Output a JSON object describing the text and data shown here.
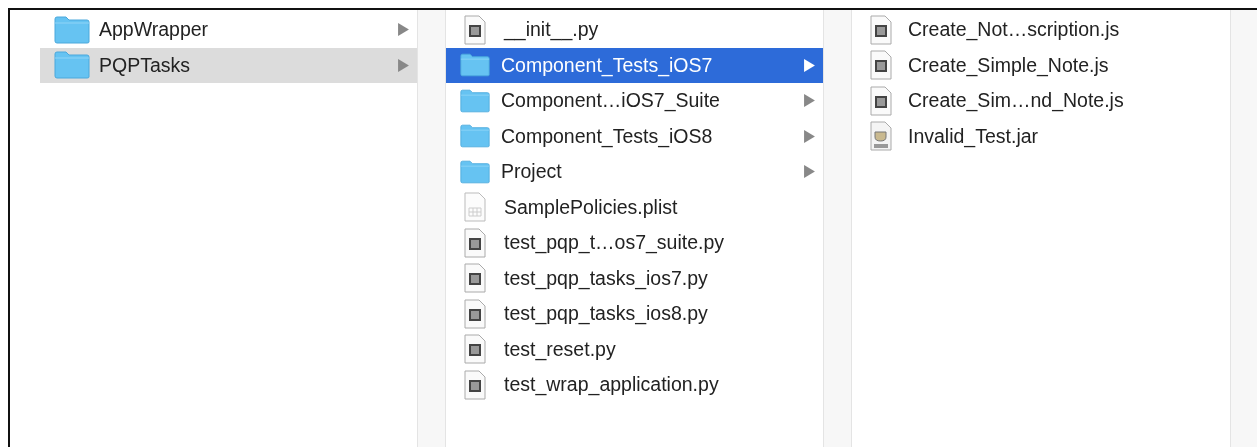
{
  "columns": [
    {
      "items": [
        {
          "kind": "folder",
          "name": "AppWrapper",
          "selected": false
        },
        {
          "kind": "folder",
          "name": "PQPTasks",
          "selected": true
        }
      ]
    },
    {
      "items": [
        {
          "kind": "script",
          "name": "__init__.py",
          "selected": false
        },
        {
          "kind": "folder",
          "name": "Component_Tests_iOS7",
          "selected": true
        },
        {
          "kind": "folder",
          "name": "Component…iOS7_Suite",
          "selected": false
        },
        {
          "kind": "folder",
          "name": "Component_Tests_iOS8",
          "selected": false
        },
        {
          "kind": "folder",
          "name": "Project",
          "selected": false
        },
        {
          "kind": "plist",
          "name": "SamplePolicies.plist",
          "selected": false
        },
        {
          "kind": "script",
          "name": "test_pqp_t…os7_suite.py",
          "selected": false
        },
        {
          "kind": "script",
          "name": "test_pqp_tasks_ios7.py",
          "selected": false
        },
        {
          "kind": "script",
          "name": "test_pqp_tasks_ios8.py",
          "selected": false
        },
        {
          "kind": "script",
          "name": "test_reset.py",
          "selected": false
        },
        {
          "kind": "script",
          "name": "test_wrap_application.py",
          "selected": false
        }
      ]
    },
    {
      "items": [
        {
          "kind": "script",
          "name": "Create_Not…scription.js",
          "selected": false
        },
        {
          "kind": "script",
          "name": "Create_Simple_Note.js",
          "selected": false
        },
        {
          "kind": "script",
          "name": "Create_Sim…nd_Note.js",
          "selected": false
        },
        {
          "kind": "jar",
          "name": "Invalid_Test.jar",
          "selected": false
        }
      ]
    }
  ]
}
